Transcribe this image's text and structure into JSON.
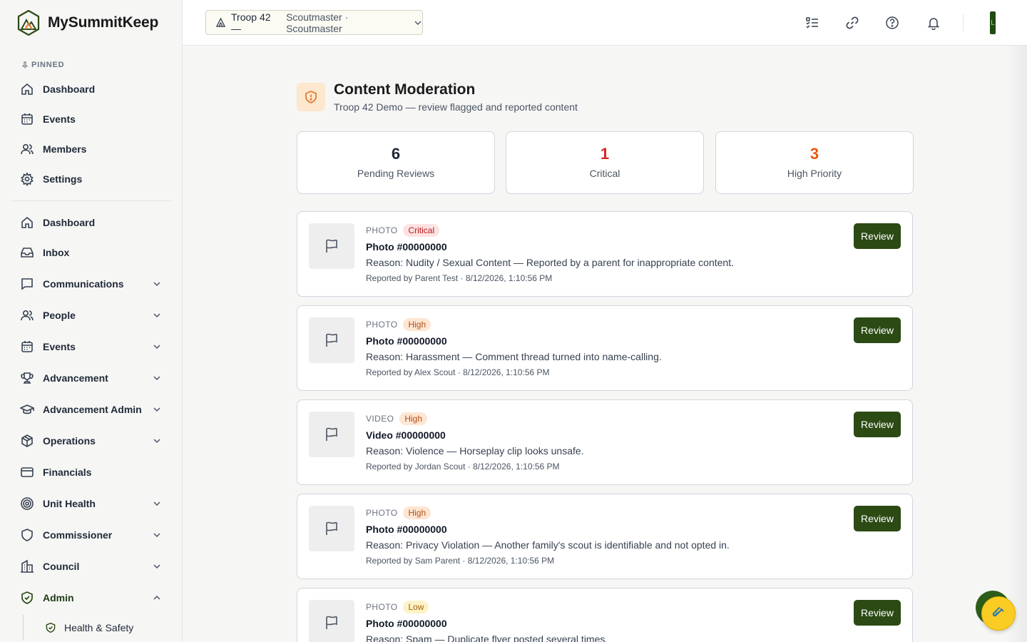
{
  "brand": {
    "name": "MySummitKeep"
  },
  "sidebar": {
    "pinned_label": "PINNED",
    "pinned": [
      {
        "label": "Dashboard",
        "icon": "home-icon"
      },
      {
        "label": "Events",
        "icon": "calendar-icon"
      },
      {
        "label": "Members",
        "icon": "users-icon"
      },
      {
        "label": "Settings",
        "icon": "gear-icon"
      }
    ],
    "items": [
      {
        "label": "Dashboard",
        "icon": "home-icon",
        "expandable": false
      },
      {
        "label": "Inbox",
        "icon": "inbox-icon",
        "expandable": false
      },
      {
        "label": "Communications",
        "icon": "message-icon",
        "expandable": true
      },
      {
        "label": "People",
        "icon": "users-icon",
        "expandable": true
      },
      {
        "label": "Events",
        "icon": "calendar-icon",
        "expandable": true
      },
      {
        "label": "Advancement",
        "icon": "trophy-icon",
        "expandable": true
      },
      {
        "label": "Advancement Admin",
        "icon": "graduation-cap-icon",
        "expandable": true
      },
      {
        "label": "Operations",
        "icon": "box-icon",
        "expandable": true
      },
      {
        "label": "Financials",
        "icon": "credit-card-icon",
        "expandable": false
      },
      {
        "label": "Unit Health",
        "icon": "target-icon",
        "expandable": true
      },
      {
        "label": "Commissioner",
        "icon": "shield-icon",
        "expandable": true
      },
      {
        "label": "Council",
        "icon": "building-icon",
        "expandable": true
      },
      {
        "label": "Admin",
        "icon": "shield-check-icon",
        "expandable": true,
        "expanded": true
      }
    ],
    "sub_items": [
      {
        "label": "Health & Safety",
        "icon": "shield-check-icon"
      }
    ]
  },
  "header": {
    "unit_name": "Troop 42 —",
    "unit_role": "Scoutmaster · Scoutmaster",
    "avatar_initial": "L"
  },
  "page": {
    "title": "Content Moderation",
    "subtitle": "Troop 42 Demo — review flagged and reported content"
  },
  "stats": [
    {
      "value": "6",
      "label": "Pending Reviews",
      "color": "#1f2937"
    },
    {
      "value": "1",
      "label": "Critical",
      "color": "#dc2626"
    },
    {
      "value": "3",
      "label": "High Priority",
      "color": "#ea580c"
    }
  ],
  "reports": [
    {
      "type": "PHOTO",
      "severity": "Critical",
      "severity_class": "critical",
      "title": "Photo #00000000",
      "reason": "Reason: Nudity / Sexual Content — Reported by a parent for inappropriate content.",
      "reported": "Reported by Parent Test · 8/12/2026, 1:10:56 PM",
      "action": "Review"
    },
    {
      "type": "PHOTO",
      "severity": "High",
      "severity_class": "high",
      "title": "Photo #00000000",
      "reason": "Reason: Harassment — Comment thread turned into name-calling.",
      "reported": "Reported by Alex Scout · 8/12/2026, 1:10:56 PM",
      "action": "Review"
    },
    {
      "type": "VIDEO",
      "severity": "High",
      "severity_class": "high",
      "title": "Video #00000000",
      "reason": "Reason: Violence — Horseplay clip looks unsafe.",
      "reported": "Reported by Jordan Scout · 8/12/2026, 1:10:56 PM",
      "action": "Review"
    },
    {
      "type": "PHOTO",
      "severity": "High",
      "severity_class": "high",
      "title": "Photo #00000000",
      "reason": "Reason: Privacy Violation — Another family's scout is identifiable and not opted in.",
      "reported": "Reported by Sam Parent · 8/12/2026, 1:10:56 PM",
      "action": "Review"
    },
    {
      "type": "PHOTO",
      "severity": "Low",
      "severity_class": "low",
      "title": "Photo #00000000",
      "reason": "Reason: Spam — Duplicate flyer posted several times.",
      "reported": "",
      "action": "Review"
    }
  ],
  "colors": {
    "accent": "#2c4a14",
    "brand_dark": "#1f4a12",
    "fab": "#fbcc23"
  }
}
